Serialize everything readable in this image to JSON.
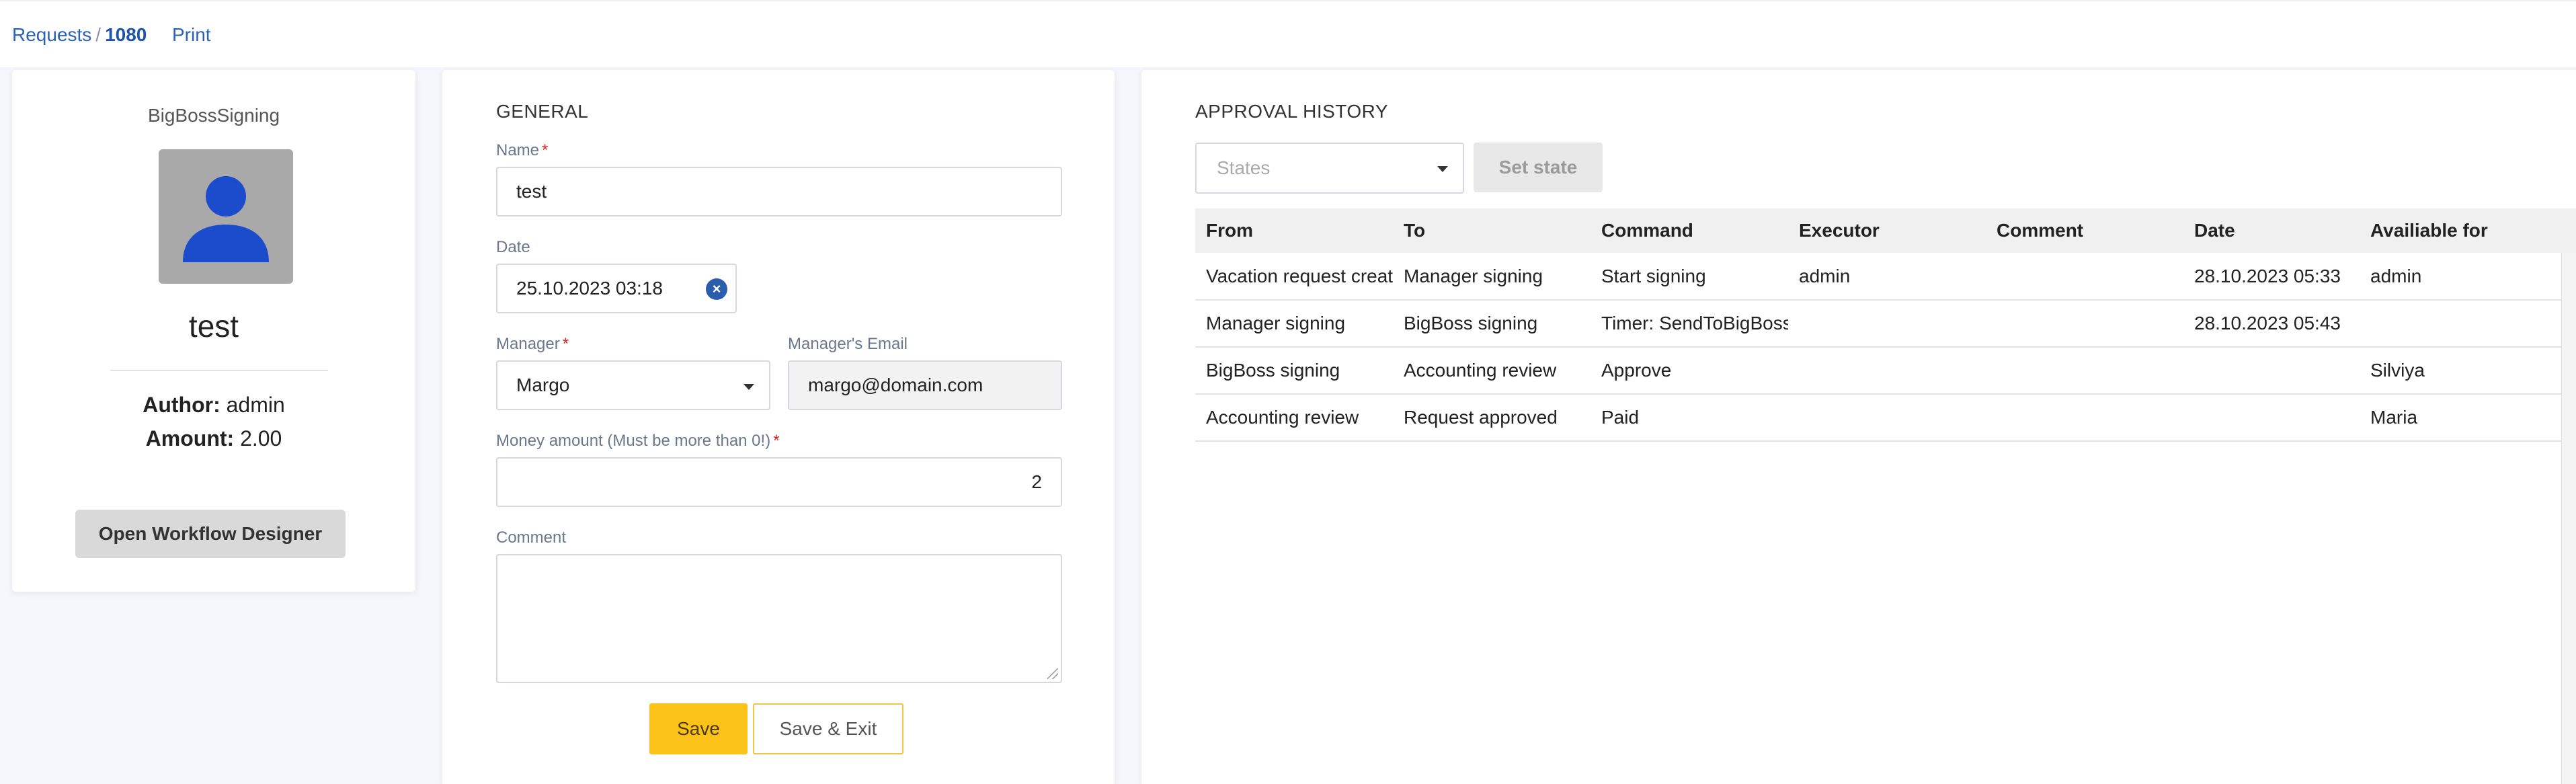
{
  "breadcrumb": {
    "root": "Requests",
    "separator": "/",
    "id": "1080"
  },
  "header": {
    "print_label": "Print"
  },
  "profile": {
    "workflow_name": "BigBossSigning",
    "avatar_icon": "user-icon",
    "title": "test",
    "author_label": "Author:",
    "author_value": "admin",
    "amount_label": "Amount:",
    "amount_value": "2.00",
    "open_designer_label": "Open Workflow Designer"
  },
  "general": {
    "title": "GENERAL",
    "name_label": "Name",
    "name_value": "test",
    "date_label": "Date",
    "date_value": "25.10.2023 03:18",
    "manager_label": "Manager",
    "manager_value": "Margo",
    "manager_email_label": "Manager's Email",
    "manager_email_value": "margo@domain.com",
    "money_label": "Money amount (Must be more than 0!)",
    "money_value": "2",
    "comment_label": "Comment",
    "comment_value": "",
    "required_mark": "*",
    "save_label": "Save",
    "save_exit_label": "Save & Exit"
  },
  "approval": {
    "title": "APPROVAL HISTORY",
    "states_placeholder": "States",
    "set_state_label": "Set state",
    "columns": [
      "From",
      "To",
      "Command",
      "Executor",
      "Comment",
      "Date",
      "Availiable for"
    ],
    "rows": [
      [
        "Vacation request created",
        "Manager signing",
        "Start signing",
        "admin",
        "",
        "28.10.2023 05:33",
        "admin"
      ],
      [
        "Manager signing",
        "BigBoss signing",
        "Timer: SendToBigBoss",
        "",
        "",
        "28.10.2023 05:43",
        ""
      ],
      [
        "BigBoss signing",
        "Accounting review",
        "Approve",
        "",
        "",
        "",
        "Silviya"
      ],
      [
        "Accounting review",
        "Request approved",
        "Paid",
        "",
        "",
        "",
        "Maria"
      ]
    ]
  },
  "colors": {
    "accent_blue": "#2c62b5",
    "save_yellow": "#fbc31a",
    "avatar_icon_blue": "#1a4ccc"
  }
}
